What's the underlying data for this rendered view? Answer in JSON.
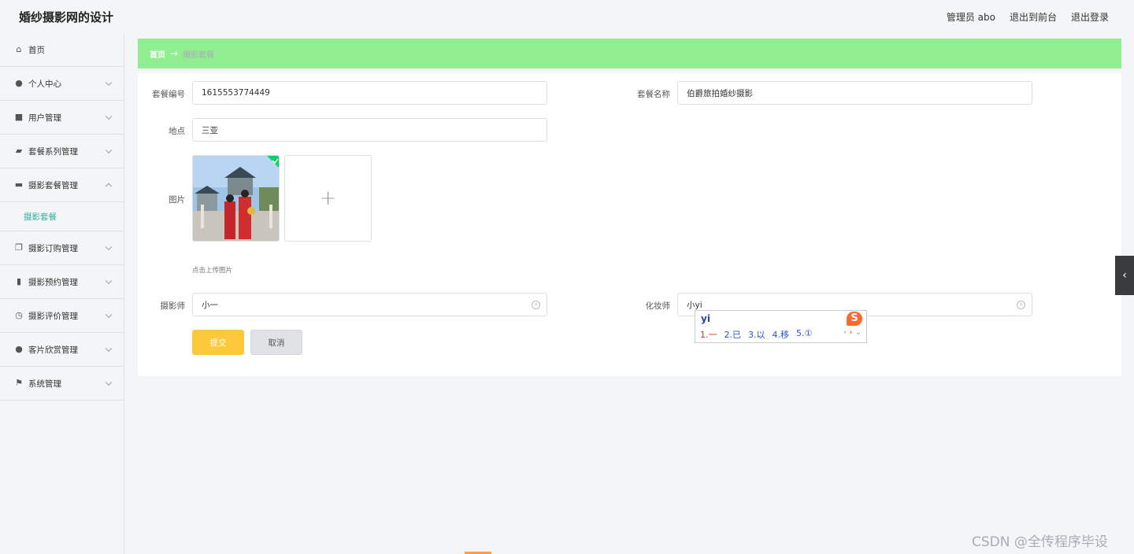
{
  "header": {
    "title": "婚纱摄影网的设计",
    "admin_label": "管理员 abo",
    "exit_front": "退出到前台",
    "logout": "退出登录"
  },
  "sidebar": {
    "items": [
      {
        "label": "首页",
        "icon": "home-icon"
      },
      {
        "label": "个人中心",
        "icon": "user-icon"
      },
      {
        "label": "用户管理",
        "icon": "briefcase-icon"
      },
      {
        "label": "套餐系列管理",
        "icon": "folder-icon"
      },
      {
        "label": "摄影套餐管理",
        "icon": "chat-icon"
      },
      {
        "label": "摄影订购管理",
        "icon": "copy-icon"
      },
      {
        "label": "摄影预约管理",
        "icon": "bar-chart-icon"
      },
      {
        "label": "摄影评价管理",
        "icon": "clock-icon"
      },
      {
        "label": "客片欣赏管理",
        "icon": "user-icon"
      },
      {
        "label": "系统管理",
        "icon": "flag-icon"
      }
    ],
    "active_sub": "摄影套餐"
  },
  "breadcrumb": {
    "home": "首页",
    "separator": "→",
    "current": "摄影套餐"
  },
  "form": {
    "package_no_label": "套餐编号",
    "package_no_value": "1615553774449",
    "package_name_label": "套餐名称",
    "package_name_value": "伯爵旅拍婚纱摄影",
    "location_label": "地点",
    "location_value": "三亚",
    "image_label": "图片",
    "upload_hint": "点击上传图片",
    "photographer_label": "摄影师",
    "photographer_value": "小一",
    "makeup_label": "化妆师",
    "makeup_value": "小yi",
    "submit_label": "提交",
    "cancel_label": "取消"
  },
  "ime": {
    "composition": "yi",
    "candidates": [
      "1.一",
      "2.已",
      "3.以",
      "4.移",
      "5.①"
    ]
  },
  "watermark": "CSDN @全传程序毕设",
  "colors": {
    "breadcrumb_bg": "#90ee90",
    "submit_bg": "#fbc93a",
    "active_sub": "#2cb09a"
  }
}
